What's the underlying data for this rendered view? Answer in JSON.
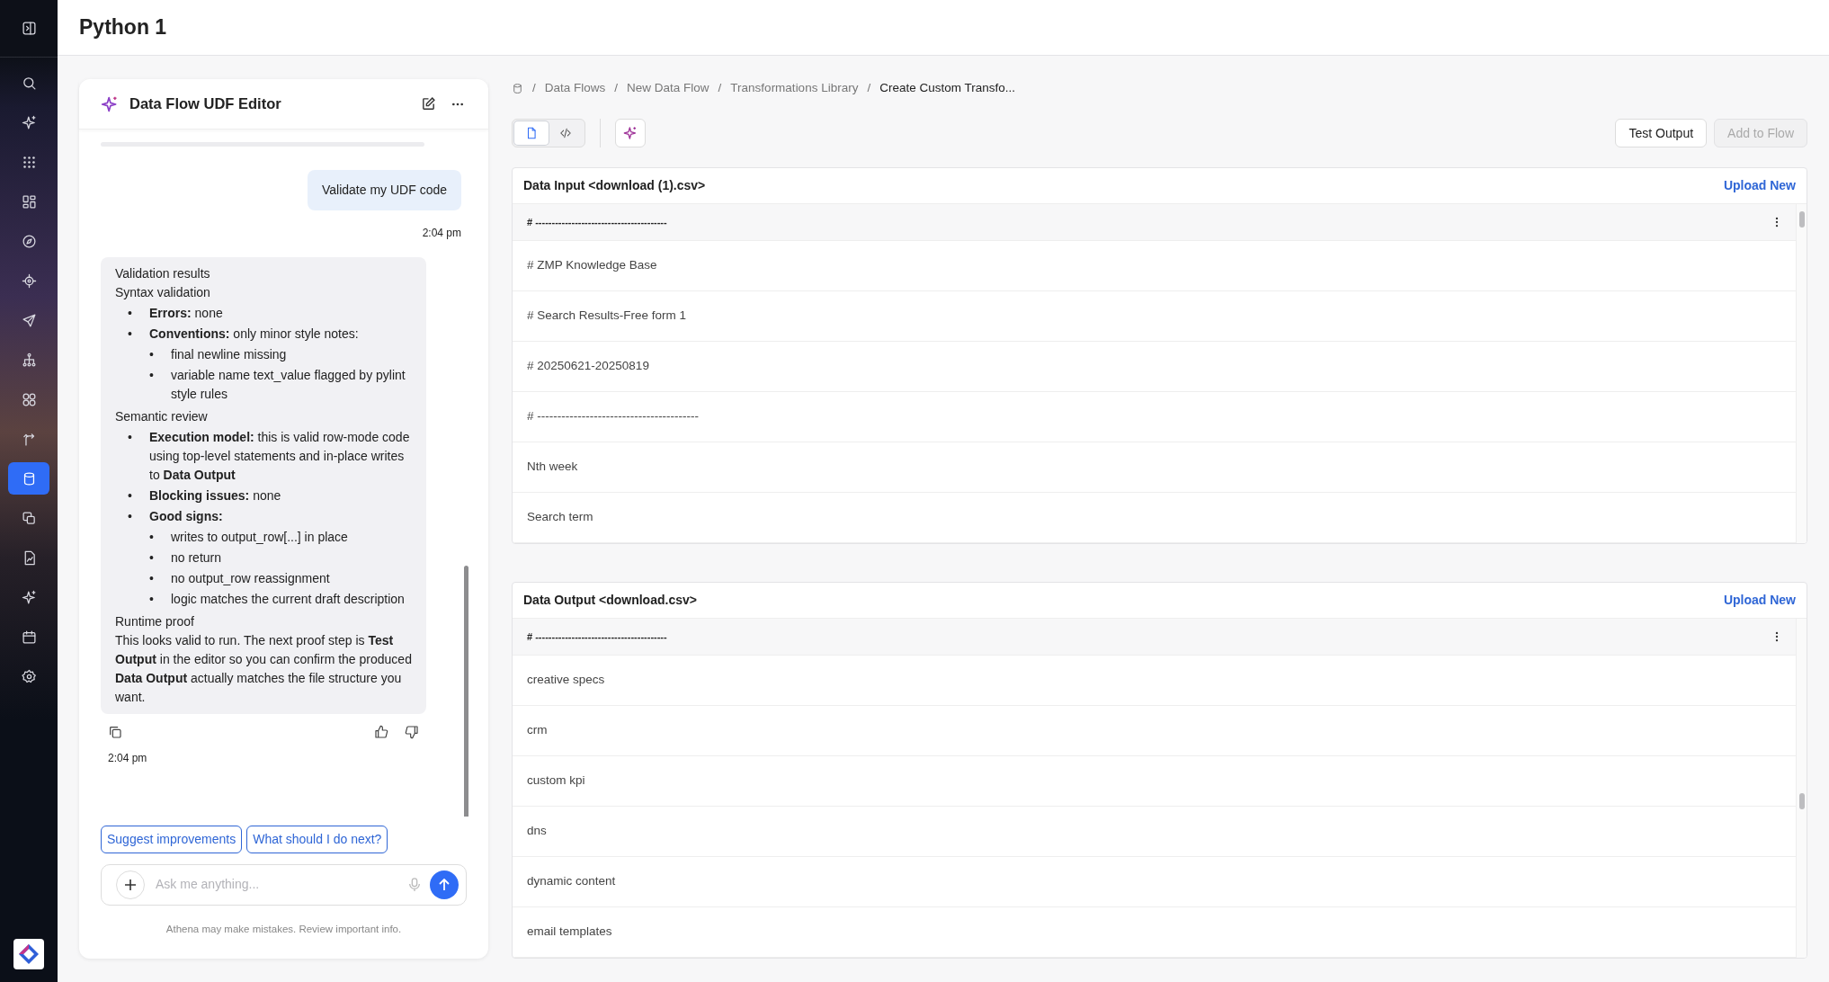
{
  "sidebar": {
    "items": [
      {
        "kind": "panel-toggle",
        "selected": false
      },
      {
        "kind": "search",
        "selected": false
      },
      {
        "kind": "sparkle",
        "selected": false
      },
      {
        "kind": "apps",
        "selected": false
      },
      {
        "kind": "dashboard",
        "selected": false
      },
      {
        "kind": "compass",
        "selected": false
      },
      {
        "kind": "target",
        "selected": false
      },
      {
        "kind": "send",
        "selected": false
      },
      {
        "kind": "hierarchy",
        "selected": false
      },
      {
        "kind": "circles",
        "selected": false
      },
      {
        "kind": "route",
        "selected": false
      },
      {
        "kind": "database",
        "selected": true
      },
      {
        "kind": "copy",
        "selected": false
      },
      {
        "kind": "report",
        "selected": false
      },
      {
        "kind": "sparkle",
        "selected": false
      },
      {
        "kind": "calendar",
        "selected": false
      },
      {
        "kind": "settings",
        "selected": false
      }
    ]
  },
  "page_title": "Python 1",
  "chat": {
    "title": "Data Flow UDF Editor",
    "messages": [
      {
        "kind": "user",
        "text": "Validate my UDF code",
        "time": "2:04 pm"
      },
      {
        "kind": "assistant",
        "time": "2:04 pm",
        "blocks": [
          {
            "kind": "text",
            "text": "Validation results"
          },
          {
            "kind": "text",
            "text": "Syntax validation"
          },
          {
            "kind": "list",
            "items": [
              {
                "text": "**Errors:** none"
              },
              {
                "text": "**Conventions:** only minor style notes:",
                "children": [
                  {
                    "text": "final newline missing"
                  },
                  {
                    "text": "variable name text_value flagged by pylint style rules"
                  }
                ]
              }
            ]
          },
          {
            "kind": "text",
            "text": "Semantic review"
          },
          {
            "kind": "list",
            "items": [
              {
                "text": "**Execution model:** this is valid row-mode code using top-level statements and in-place writes to **Data Output**"
              },
              {
                "text": "**Blocking issues:** none"
              },
              {
                "text": "**Good signs:**",
                "children": [
                  {
                    "text": "writes to output_row[...] in place"
                  },
                  {
                    "text": "no return"
                  },
                  {
                    "text": "no output_row reassignment"
                  },
                  {
                    "text": "logic matches the current draft description"
                  }
                ]
              }
            ]
          },
          {
            "kind": "text",
            "text": "Runtime proof"
          },
          {
            "kind": "text",
            "text": "This looks valid to run. The next proof step is **Test Output** in the editor so you can confirm the produced **Data Output** actually matches the file structure you want."
          }
        ]
      }
    ],
    "list_marker": "•",
    "suggestions": [
      "Suggest improvements",
      "What should I do next?"
    ],
    "input": {
      "placeholder": "Ask me anything..."
    },
    "disclaimer": "Athena may make mistakes. Review important info."
  },
  "breadcrumb_separator": "/",
  "breadcrumb": [
    "Data Flows",
    "New Data Flow",
    "Transformations Library",
    "Create Custom Transfo..."
  ],
  "view_toggle": [
    {
      "kind": "file",
      "selected": true
    },
    {
      "kind": "code",
      "selected": false
    }
  ],
  "actions": [
    {
      "label": "Test Output",
      "disabled": false
    },
    {
      "label": "Add to Flow",
      "disabled": true
    }
  ],
  "panels": [
    {
      "title": "Data Input <download (1).csv>",
      "action": "Upload New",
      "header": "# ----------------------------------------",
      "rows": [
        "# ZMP Knowledge Base",
        "# Search Results-Free form 1",
        "# 20250621-20250819",
        "# ----------------------------------------",
        "Nth week",
        "Search term"
      ]
    },
    {
      "title": "Data Output <download.csv>",
      "action": "Upload New",
      "header": "# ----------------------------------------",
      "rows": [
        "creative specs",
        "crm",
        "custom kpi",
        "dns",
        "dynamic content",
        "email templates"
      ]
    }
  ]
}
